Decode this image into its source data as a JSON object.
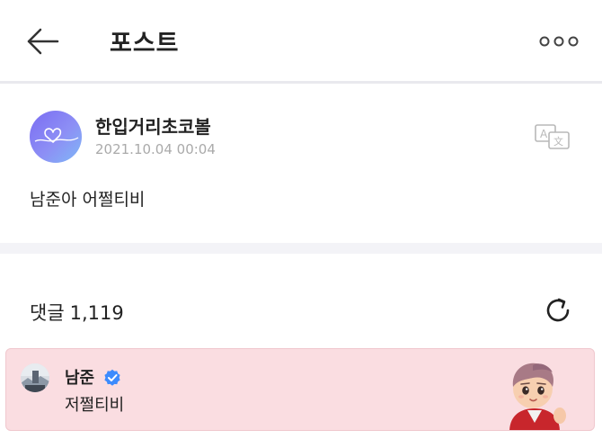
{
  "header": {
    "title": "포스트",
    "back_icon": "arrow-left-icon",
    "more_icon": "more-dots-icon"
  },
  "post": {
    "author": "한입거리초코볼",
    "timestamp": "2021.10.04 00:04",
    "body": "남준아 어쩔티비",
    "translate_icon": "translate-icon"
  },
  "comments": {
    "label": "댓글",
    "count": "1,119",
    "refresh_icon": "refresh-icon",
    "items": [
      {
        "author": "남준",
        "verified": true,
        "text": "저쩔티비"
      }
    ]
  },
  "colors": {
    "highlight_bg": "#fadde1",
    "verified_blue": "#3d8bfd",
    "timestamp_gray": "#aaaaaa",
    "divider": "#e9e9ee"
  }
}
